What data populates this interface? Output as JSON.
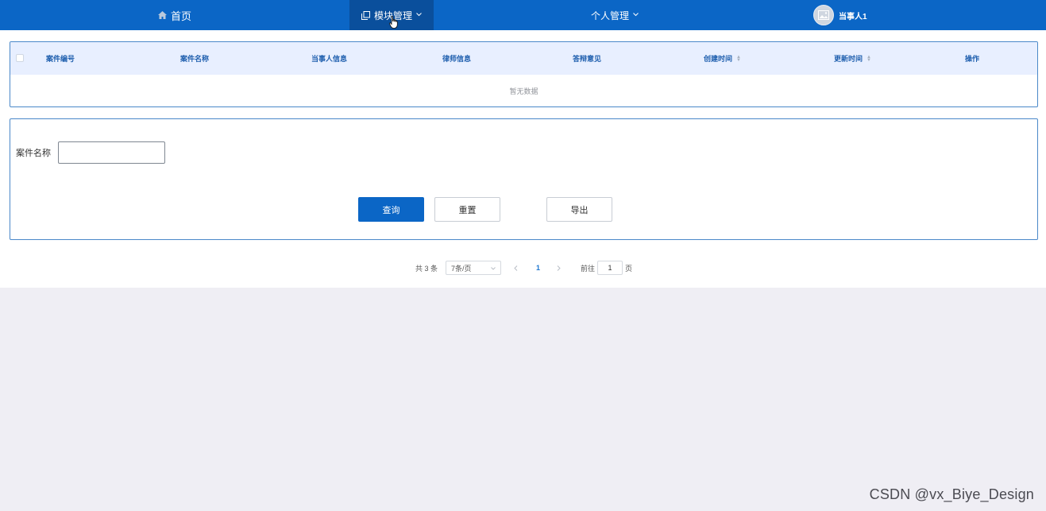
{
  "nav": {
    "home": "首页",
    "module": "模块管理",
    "personal": "个人管理",
    "user": "当事人1"
  },
  "table": {
    "columns": [
      "案件编号",
      "案件名称",
      "当事人信息",
      "律师信息",
      "答辩意见",
      "创建时间",
      "更新时间",
      "操作"
    ],
    "empty_text": "暂无数据"
  },
  "search": {
    "label": "案件名称",
    "value": "",
    "query_button": "查询",
    "reset_button": "重置",
    "export_button": "导出"
  },
  "pagination": {
    "total_text": "共 3 条",
    "page_size": "7条/页",
    "current_page": "1",
    "goto_label": "前往",
    "goto_value": "1",
    "page_suffix": "页"
  },
  "watermark": "CSDN @vx_Biye_Design",
  "colors": {
    "nav_bg": "#0b66c6",
    "nav_active_bg": "#0a4f9c",
    "table_header_bg": "#e8efff",
    "primary": "#0b66c6",
    "page_bg": "#efeef4"
  }
}
